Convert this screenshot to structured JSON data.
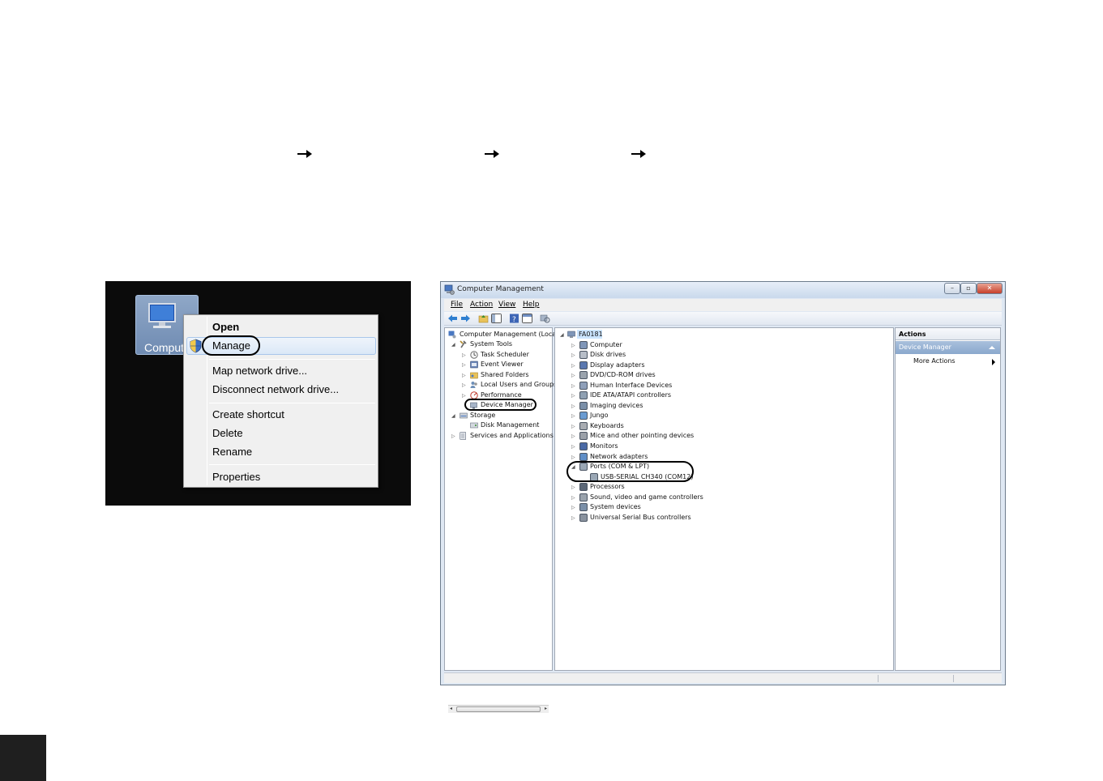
{
  "context_menu": {
    "desktop_icon_label": "Comput",
    "items": [
      {
        "label": "Open"
      },
      {
        "label": "Manage"
      },
      {
        "label": "Map network drive..."
      },
      {
        "label": "Disconnect network drive..."
      },
      {
        "label": "Create shortcut"
      },
      {
        "label": "Delete"
      },
      {
        "label": "Rename"
      },
      {
        "label": "Properties"
      }
    ]
  },
  "window": {
    "title": "Computer Management",
    "controls": {
      "minimize": "–",
      "maximize": "▫",
      "close": "✕"
    },
    "menubar": [
      "File",
      "Action",
      "View",
      "Help"
    ],
    "left_tree": {
      "root": "Computer Management (Local",
      "system_tools": "System Tools",
      "system_children": [
        "Task Scheduler",
        "Event Viewer",
        "Shared Folders",
        "Local Users and Groups",
        "Performance",
        "Device Manager"
      ],
      "storage": "Storage",
      "storage_children": [
        "Disk Management"
      ],
      "services": "Services and Applications"
    },
    "device_tree": {
      "root": "FA0181",
      "categories": [
        "Computer",
        "Disk drives",
        "Display adapters",
        "DVD/CD-ROM drives",
        "Human Interface Devices",
        "IDE ATA/ATAPI controllers",
        "Imaging devices",
        "Jungo",
        "Keyboards",
        "Mice and other pointing devices",
        "Monitors",
        "Network adapters",
        "Ports (COM & LPT)"
      ],
      "port_child": "USB-SERIAL CH340 (COM12)",
      "categories_after": [
        "Processors",
        "Sound, video and game controllers",
        "System devices",
        "Universal Serial Bus controllers"
      ]
    },
    "actions": {
      "header": "Actions",
      "selected": "Device Manager",
      "more": "More Actions"
    }
  },
  "colors": {
    "highlight_oval": "#000000",
    "desktop_background": "#0b0b0b",
    "window_frame": "#dfe8f3",
    "actions_selected": "#8aa8cd"
  }
}
